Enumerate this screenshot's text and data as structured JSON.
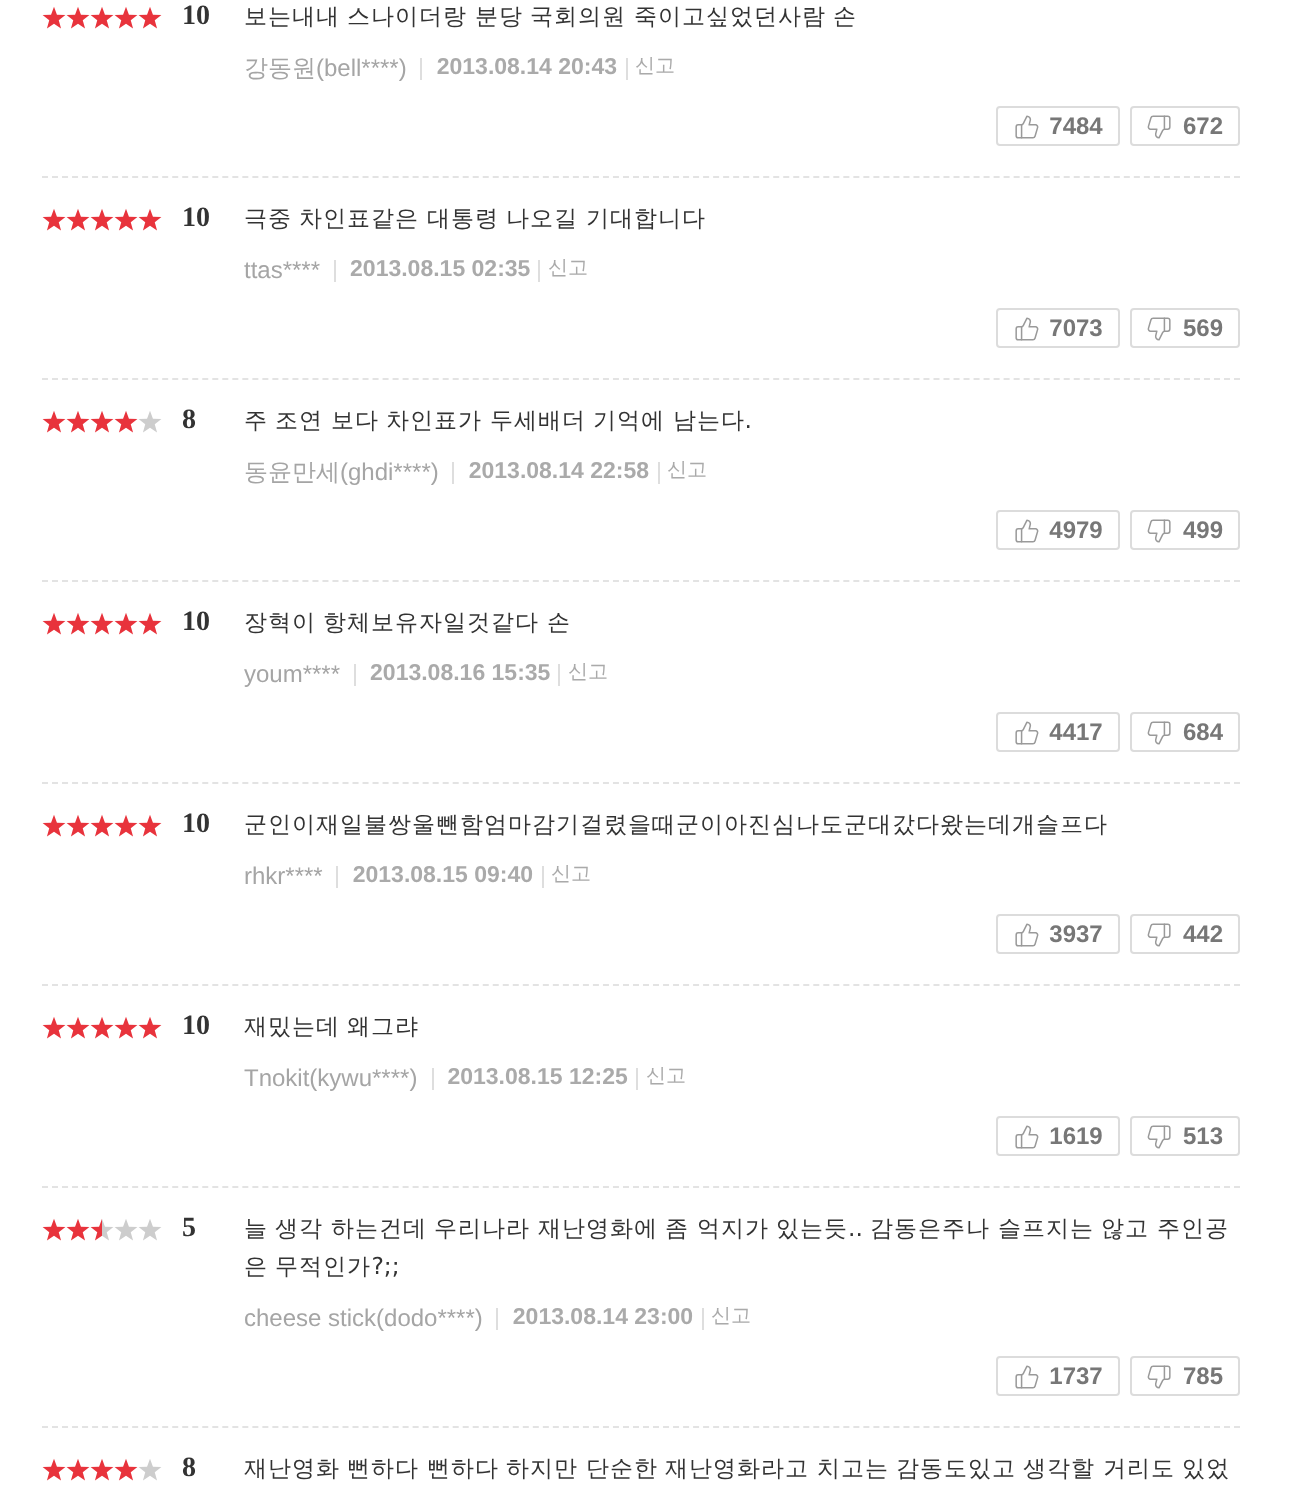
{
  "reviews": [
    {
      "stars": 5,
      "score": "10",
      "text": "보는내내 스나이더랑 분당 국회의원 죽이고싶었던사람 손",
      "author": "강동원(bell****)",
      "date": "2013.08.14 20:43",
      "report": "신고",
      "likes": "7484",
      "dislikes": "672"
    },
    {
      "stars": 5,
      "score": "10",
      "text": "극중 차인표같은 대통령 나오길 기대합니다",
      "author": "ttas****",
      "date": "2013.08.15 02:35",
      "report": "신고",
      "likes": "7073",
      "dislikes": "569"
    },
    {
      "stars": 4,
      "score": "8",
      "text": "주 조연 보다 차인표가 두세배더 기억에 남는다.",
      "author": "동윤만세(ghdi****)",
      "date": "2013.08.14 22:58",
      "report": "신고",
      "likes": "4979",
      "dislikes": "499"
    },
    {
      "stars": 5,
      "score": "10",
      "text": "장혁이 항체보유자일것같다 손",
      "author": "youm****",
      "date": "2013.08.16 15:35",
      "report": "신고",
      "likes": "4417",
      "dislikes": "684"
    },
    {
      "stars": 5,
      "score": "10",
      "text": "군인이재일불쌍울뺀함엄마감기걸렸을때군이아진심나도군대갔다왔는데개슬프다",
      "author": "rhkr****",
      "date": "2013.08.15 09:40",
      "report": "신고",
      "likes": "3937",
      "dislikes": "442"
    },
    {
      "stars": 5,
      "score": "10",
      "text": "재밌는데 왜그랴",
      "author": "Tnokit(kywu****)",
      "date": "2013.08.15 12:25",
      "report": "신고",
      "likes": "1619",
      "dislikes": "513"
    },
    {
      "stars": 2.5,
      "score": "5",
      "text": "늘 생각 하는건데 우리나라 재난영화에 좀 억지가 있는듯.. 감동은주나 슬프지는 않고 주인공은 무적인가?;;",
      "author": "cheese stick(dodo****)",
      "date": "2013.08.14 23:00",
      "report": "신고",
      "likes": "1737",
      "dislikes": "785"
    },
    {
      "stars": 4,
      "score": "8",
      "text": "재난영화 뻔하다 뻔하다 하지만 단순한 재난영화라고 치고는 감동도있고 생각할 거리도 있었"
    }
  ]
}
